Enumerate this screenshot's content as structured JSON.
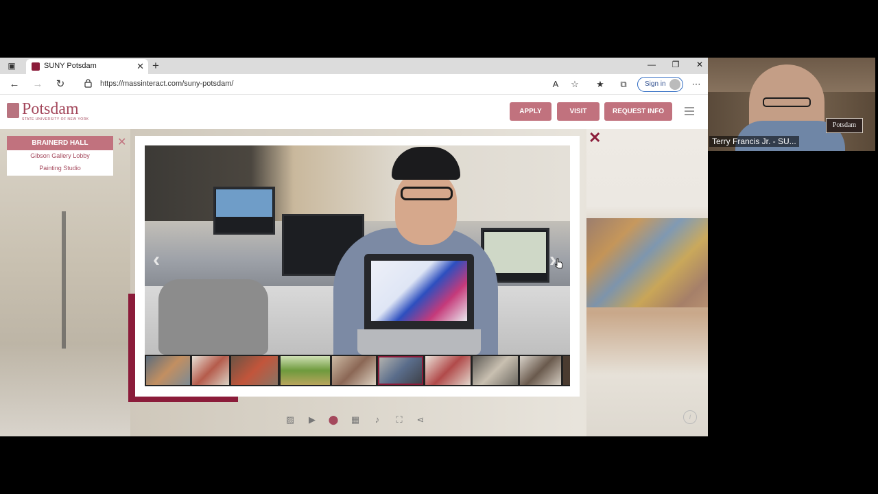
{
  "browser": {
    "tab_title": "SUNY Potsdam",
    "url": "https://massinteract.com/suny-potsdam/",
    "sign_in_label": "Sign in"
  },
  "site": {
    "logo_text": "Potsdam",
    "logo_subtext": "STATE UNIVERSITY OF NEW YORK",
    "buttons": {
      "apply": "APPLY",
      "visit": "VISIT",
      "request_info": "REQUEST INFO"
    }
  },
  "location_menu": {
    "header": "BRAINERD HALL",
    "items": [
      "Gibson Gallery Lobby",
      "Painting Studio"
    ]
  },
  "gallery": {
    "thumbnail_count": 9,
    "selected_thumbnail_index": 6
  },
  "webcam": {
    "participant_name": "Terry Francis Jr. - SU...",
    "background_sign": "Potsdam"
  },
  "colors": {
    "brand_maroon": "#8b1c3a",
    "brand_rose": "#c1727e",
    "signin_blue": "#2f6bc2"
  }
}
